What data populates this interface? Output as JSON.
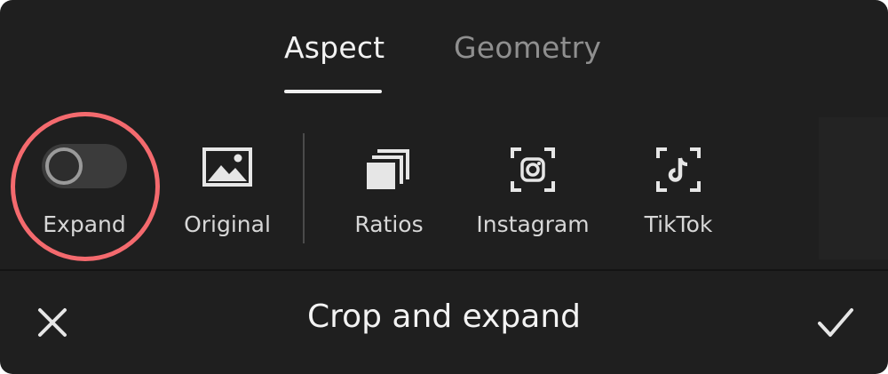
{
  "tabs": [
    {
      "label": "Aspect",
      "active": true
    },
    {
      "label": "Geometry",
      "active": false
    }
  ],
  "tools": {
    "expand": {
      "label": "Expand",
      "toggle_on": false,
      "icon": "toggle-switch"
    },
    "original": {
      "label": "Original",
      "icon": "image-icon"
    },
    "ratios": {
      "label": "Ratios",
      "icon": "stacked-frames-icon"
    },
    "instagram": {
      "label": "Instagram",
      "icon": "instagram-icon"
    },
    "tiktok": {
      "label": "TikTok",
      "icon": "tiktok-icon"
    }
  },
  "bottom_bar": {
    "title": "Crop and expand",
    "close_icon": "close-icon",
    "confirm_icon": "checkmark-icon"
  },
  "colors": {
    "background": "#1f1f1f",
    "highlight": "#f46a6e",
    "active_tab": "#f2f2f2",
    "inactive_tab": "#8f8f8f"
  }
}
